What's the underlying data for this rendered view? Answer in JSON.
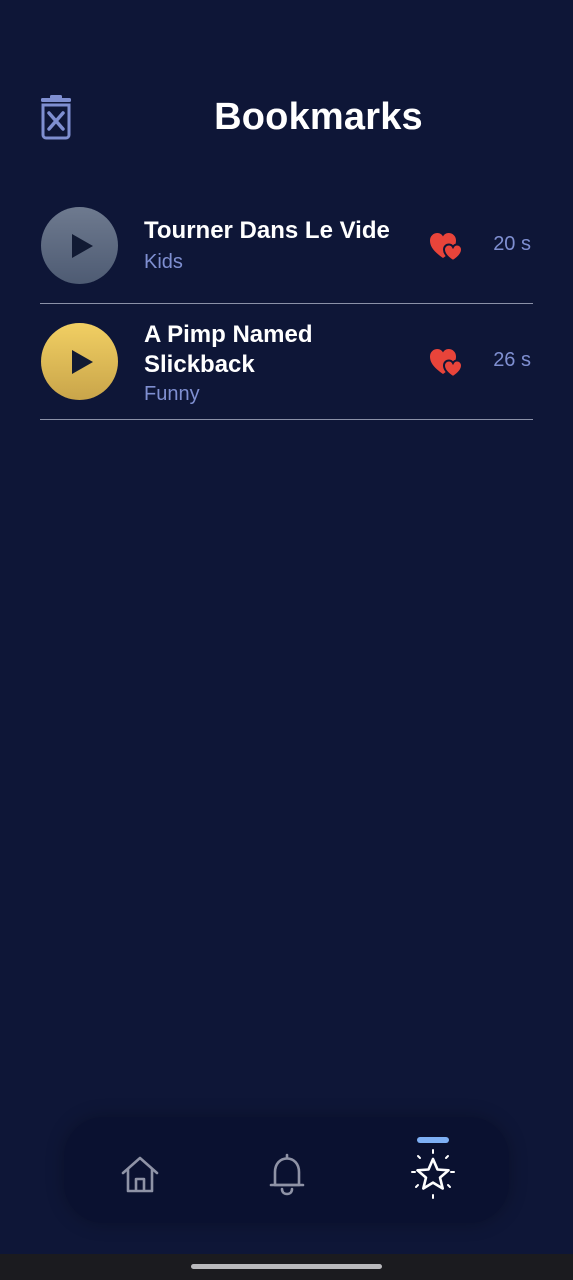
{
  "header": {
    "title": "Bookmarks",
    "clear_icon": "trash-x-icon"
  },
  "bookmarks": [
    {
      "title": "Tourner Dans Le Vide",
      "category": "Kids",
      "duration": "20 s",
      "play_color": "#5d6a82",
      "favorite_icon": "hearts-icon",
      "favorite_color": "#e8443a"
    },
    {
      "title": "A Pimp Named Slickback",
      "category": "Funny",
      "duration": "26 s",
      "play_color": "#dcb955",
      "favorite_icon": "hearts-icon",
      "favorite_color": "#e8443a"
    }
  ],
  "bottom_nav": {
    "items": [
      {
        "icon": "home-icon",
        "active": false
      },
      {
        "icon": "bell-icon",
        "active": false
      },
      {
        "icon": "star-icon",
        "active": true
      }
    ],
    "indicator_color": "#7eb0f5"
  },
  "colors": {
    "background": "#0e1637",
    "accent_text": "#7f8fd1",
    "divider": "#8b91a8"
  }
}
